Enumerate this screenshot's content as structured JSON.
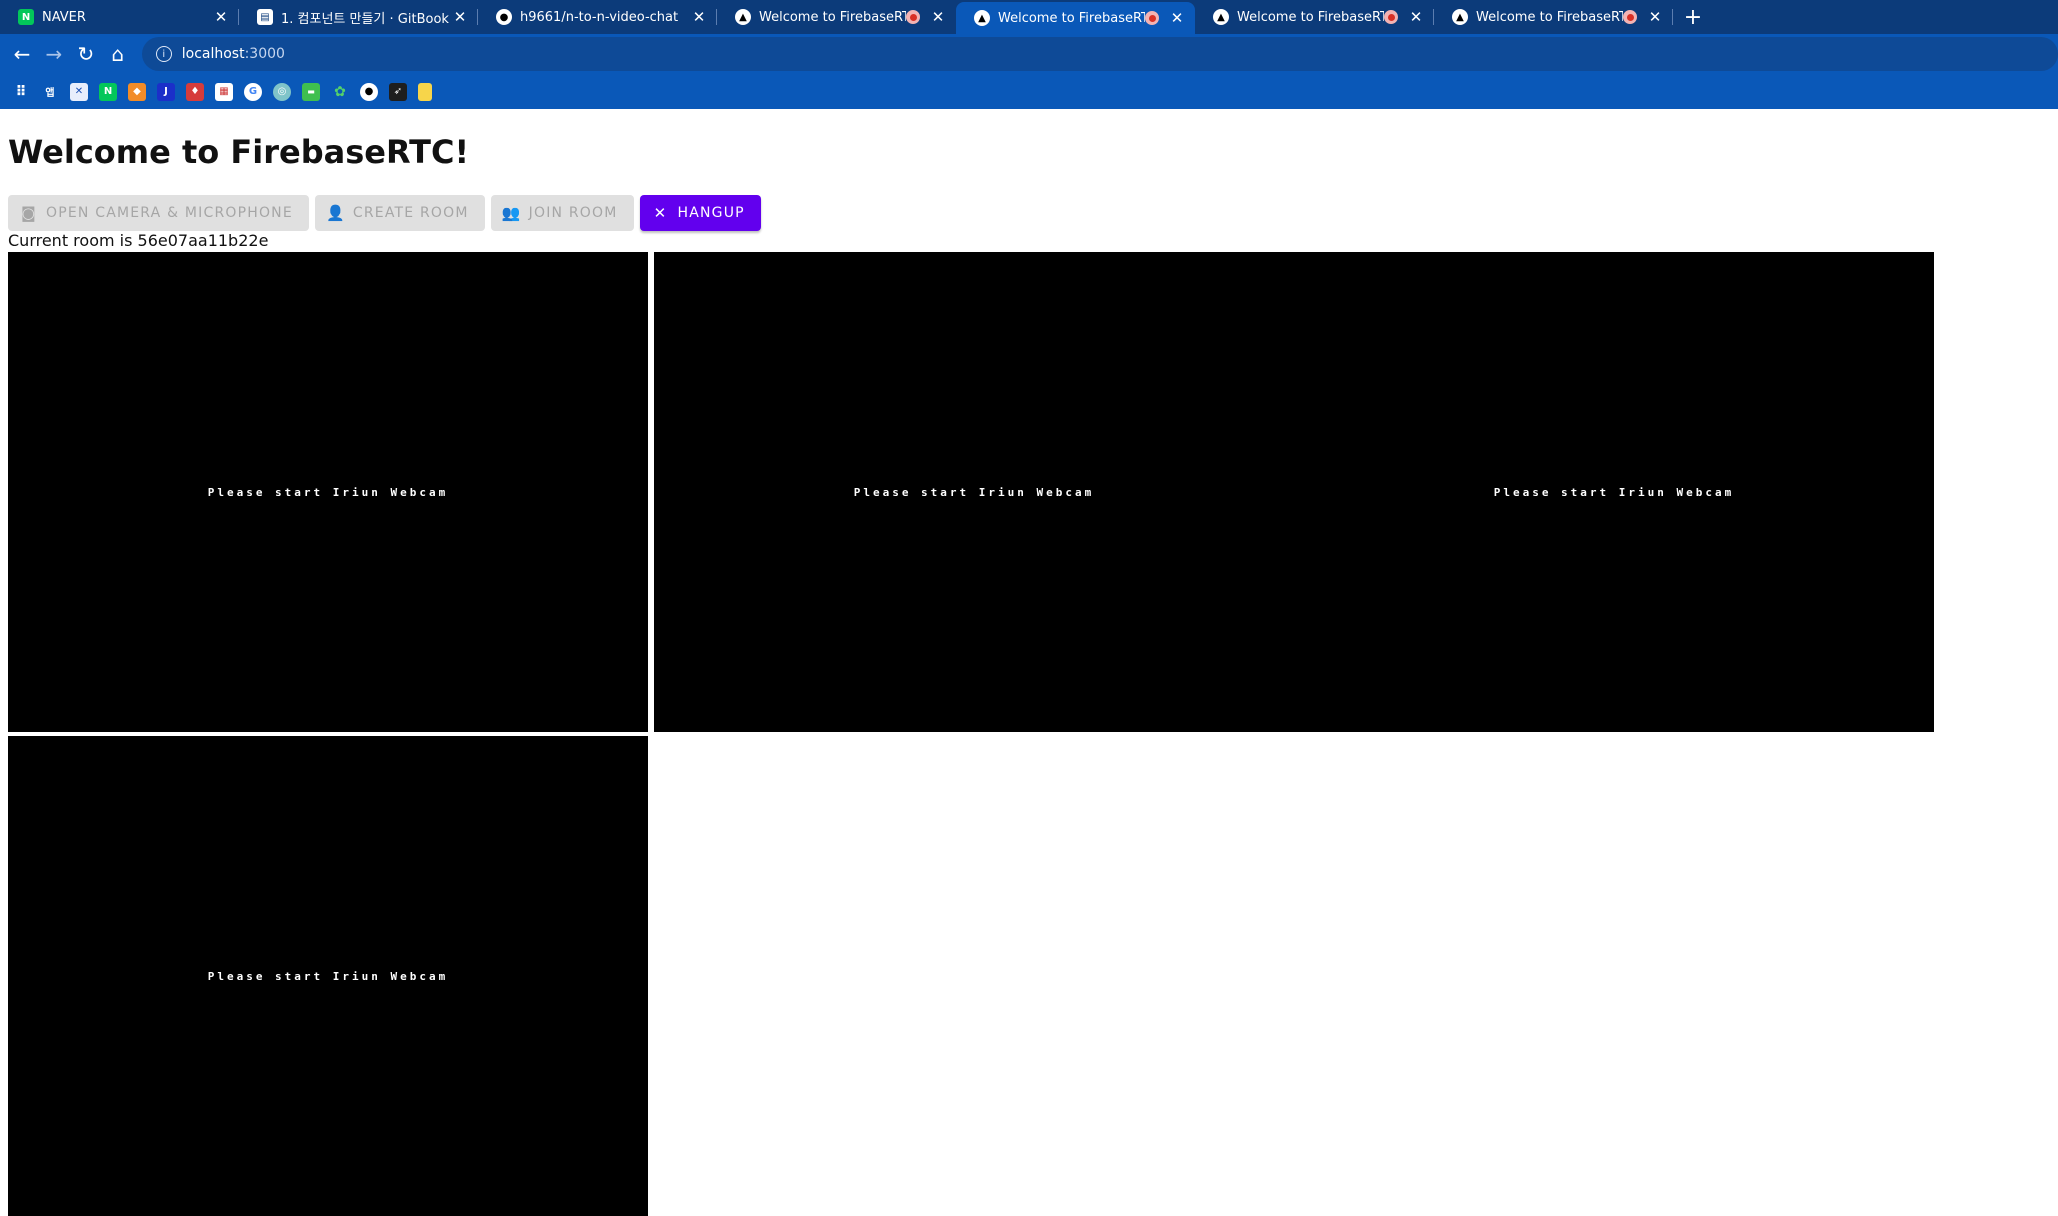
{
  "tabs": [
    {
      "title": "NAVER",
      "icon": "naver-icon",
      "active": false
    },
    {
      "title": "1. 컴포넌트 만들기 · GitBook",
      "icon": "gitbook-icon",
      "active": false
    },
    {
      "title": "h9661/n-to-n-video-chat",
      "icon": "github-icon",
      "active": false
    },
    {
      "title": "Welcome to FirebaseRTC",
      "icon": "app-icon",
      "active": false
    },
    {
      "title": "Welcome to FirebaseRTC",
      "icon": "app-icon",
      "active": true
    },
    {
      "title": "Welcome to FirebaseRTC",
      "icon": "app-icon",
      "active": false
    },
    {
      "title": "Welcome to FirebaseRTC",
      "icon": "app-icon",
      "active": false
    }
  ],
  "address": {
    "host": "localhost",
    "port": ":3000"
  },
  "page": {
    "heading": "Welcome to FirebaseRTC!",
    "buttons": {
      "open_camera": "Open camera & microphone",
      "create_room": "Create room",
      "join_room": "Join room",
      "hangup": "Hangup"
    },
    "current_room": "Current room is 56e07aa11b22e",
    "video_message": "Please start Iriun Webcam"
  },
  "colors": {
    "tabstrip": "#0c3b7a",
    "toolbar": "#0a58b8",
    "primary": "#6200ee",
    "disabled_bg": "#e0e0e0"
  }
}
